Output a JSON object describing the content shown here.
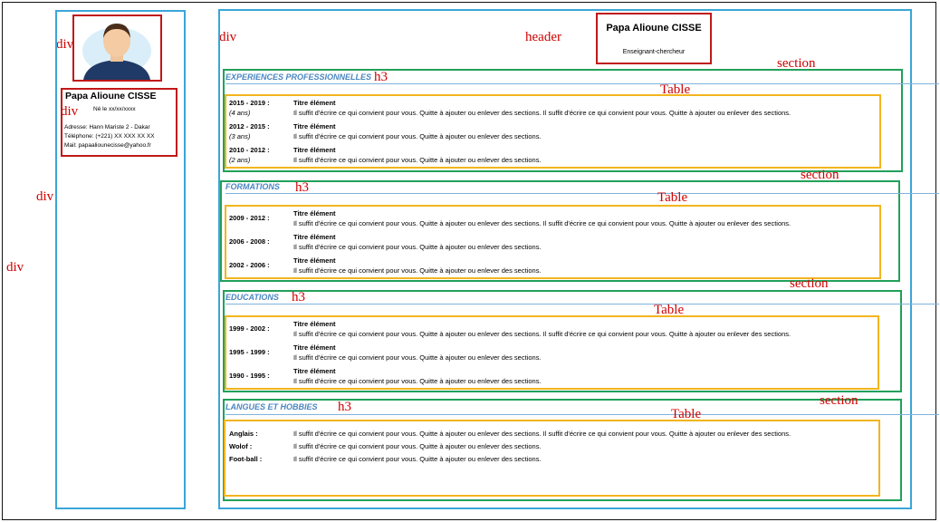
{
  "labels": {
    "div": "div",
    "header": "header",
    "section": "section",
    "h3": "h3",
    "table": "Table"
  },
  "profile": {
    "name": "Papa Alioune CISSE",
    "born": "Né le xx/xx/xxxx",
    "address": "Adresse: Hann Mariste 2 - Dakar",
    "phone": "Téléphone: (+221) XX XXX XX XX",
    "mail": "Mail: papaaliounecisse@yahoo.fr"
  },
  "header": {
    "name": "Papa Alioune CISSE",
    "role": "Enseignant-chercheur"
  },
  "sections": [
    {
      "title": "EXPERIENCES PROFESSIONNELLES",
      "rows": [
        {
          "date": "2015 - 2019 :",
          "sub": "(4 ans)",
          "title": "Titre élément",
          "text": "Il suffit d'écrire ce qui convient pour vous. Quitte à ajouter ou enlever des sections. Il suffit d'écrire ce qui convient pour vous. Quitte à ajouter ou enlever des sections."
        },
        {
          "date": "2012 - 2015 :",
          "sub": "(3 ans)",
          "title": "Titre élément",
          "text": "Il suffit d'écrire ce qui convient pour vous. Quitte à ajouter ou enlever des sections."
        },
        {
          "date": "2010 - 2012 :",
          "sub": "(2 ans)",
          "title": "Titre élément",
          "text": "Il suffit d'écrire ce qui convient pour vous. Quitte à ajouter ou enlever des sections."
        }
      ]
    },
    {
      "title": "FORMATIONS",
      "rows": [
        {
          "date": "2009 - 2012 :",
          "title": "Titre élément",
          "text": "Il suffit d'écrire ce qui convient pour vous. Quitte à ajouter ou enlever des sections. Il suffit d'écrire ce qui convient pour vous. Quitte à ajouter ou enlever des sections."
        },
        {
          "date": "2006 - 2008 :",
          "title": "Titre élément",
          "text": "Il suffit d'écrire ce qui convient pour vous. Quitte à ajouter ou enlever des sections."
        },
        {
          "date": "2002 - 2006 :",
          "title": "Titre élément",
          "text": "Il suffit d'écrire ce qui convient pour vous. Quitte à ajouter ou enlever des sections."
        }
      ]
    },
    {
      "title": "EDUCATIONS",
      "rows": [
        {
          "date": "1999 - 2002 :",
          "title": "Titre élément",
          "text": "Il suffit d'écrire ce qui convient pour vous. Quitte à ajouter ou enlever des sections. Il suffit d'écrire ce qui convient pour vous. Quitte à ajouter ou enlever des sections."
        },
        {
          "date": "1995 - 1999 :",
          "title": "Titre élément",
          "text": "Il suffit d'écrire ce qui convient pour vous. Quitte à ajouter ou enlever des sections."
        },
        {
          "date": "1990 - 1995 :",
          "title": "Titre élément",
          "text": "Il suffit d'écrire ce qui convient pour vous. Quitte à ajouter ou enlever des sections."
        }
      ]
    },
    {
      "title": "LANGUES ET HOBBIES",
      "rows": [
        {
          "date": "Anglais :",
          "text": "Il suffit d'écrire ce qui convient pour vous. Quitte à ajouter ou enlever des sections. Il suffit d'écrire ce qui convient pour vous. Quitte à ajouter ou enlever des sections."
        },
        {
          "date": "Wolof :",
          "text": "Il suffit d'écrire ce qui convient pour vous. Quitte à ajouter ou enlever des sections."
        },
        {
          "date": "Foot-ball :",
          "text": "Il suffit d'écrire ce qui convient pour vous. Quitte à ajouter ou enlever des sections."
        }
      ]
    }
  ]
}
